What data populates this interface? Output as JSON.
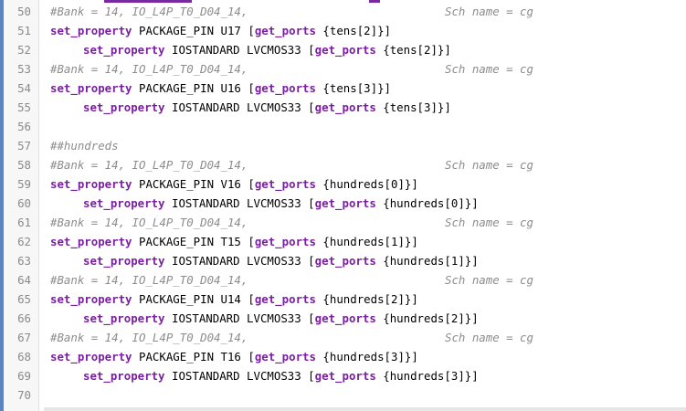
{
  "editor": {
    "lines": [
      {
        "num": "50",
        "kind": "comment",
        "comment": "#Bank = 14, IO_L4P_T0_D04_14,",
        "right": "Sch name = cg"
      },
      {
        "num": "51",
        "kind": "pin",
        "cmd": "set_property",
        "mid": " PACKAGE_PIN U17 [",
        "kw2": "get_ports",
        "tail": " {tens[2]}]"
      },
      {
        "num": "52",
        "kind": "std",
        "cmd": "set_property",
        "mid": " IOSTANDARD LVCMOS33 [",
        "kw2": "get_ports",
        "tail": " {tens[2]}]"
      },
      {
        "num": "53",
        "kind": "comment",
        "comment": "#Bank = 14, IO_L4P_T0_D04_14,",
        "right": "Sch name = cg"
      },
      {
        "num": "54",
        "kind": "pin",
        "cmd": "set_property",
        "mid": " PACKAGE_PIN U16 [",
        "kw2": "get_ports",
        "tail": " {tens[3]}]"
      },
      {
        "num": "55",
        "kind": "std",
        "cmd": "set_property",
        "mid": " IOSTANDARD LVCMOS33 [",
        "kw2": "get_ports",
        "tail": " {tens[3]}]"
      },
      {
        "num": "56",
        "kind": "blank"
      },
      {
        "num": "57",
        "kind": "comment",
        "comment": "##hundreds",
        "right": ""
      },
      {
        "num": "58",
        "kind": "comment",
        "comment": "#Bank = 14, IO_L4P_T0_D04_14,",
        "right": "Sch name = cg"
      },
      {
        "num": "59",
        "kind": "pin",
        "cmd": "set_property",
        "mid": " PACKAGE_PIN V16 [",
        "kw2": "get_ports",
        "tail": " {hundreds[0]}]"
      },
      {
        "num": "60",
        "kind": "std",
        "cmd": "set_property",
        "mid": " IOSTANDARD LVCMOS33 [",
        "kw2": "get_ports",
        "tail": " {hundreds[0]}]"
      },
      {
        "num": "61",
        "kind": "comment",
        "comment": "#Bank = 14, IO_L4P_T0_D04_14,",
        "right": "Sch name = cg"
      },
      {
        "num": "62",
        "kind": "pin",
        "cmd": "set_property",
        "mid": " PACKAGE_PIN T15 [",
        "kw2": "get_ports",
        "tail": " {hundreds[1]}]"
      },
      {
        "num": "63",
        "kind": "std",
        "cmd": "set_property",
        "mid": " IOSTANDARD LVCMOS33 [",
        "kw2": "get_ports",
        "tail": " {hundreds[1]}]"
      },
      {
        "num": "64",
        "kind": "comment",
        "comment": "#Bank = 14, IO_L4P_T0_D04_14,",
        "right": "Sch name = cg"
      },
      {
        "num": "65",
        "kind": "pin",
        "cmd": "set_property",
        "mid": " PACKAGE_PIN U14 [",
        "kw2": "get_ports",
        "tail": " {hundreds[2]}]"
      },
      {
        "num": "66",
        "kind": "std",
        "cmd": "set_property",
        "mid": " IOSTANDARD LVCMOS33 [",
        "kw2": "get_ports",
        "tail": " {hundreds[2]}]"
      },
      {
        "num": "67",
        "kind": "comment",
        "comment": "#Bank = 14, IO_L4P_T0_D04_14,",
        "right": "Sch name = cg"
      },
      {
        "num": "68",
        "kind": "pin",
        "cmd": "set_property",
        "mid": " PACKAGE_PIN T16 [",
        "kw2": "get_ports",
        "tail": " {hundreds[3]}]"
      },
      {
        "num": "69",
        "kind": "std",
        "cmd": "set_property",
        "mid": " IOSTANDARD LVCMOS33 [",
        "kw2": "get_ports",
        "tail": " {hundreds[3]}]"
      },
      {
        "num": "70",
        "kind": "blank"
      }
    ]
  },
  "colors": {
    "keyword": "#7b1fa2",
    "comment": "#8c8c8c",
    "line_number": "#8a8a8a",
    "accent_bar": "#5b86c4"
  }
}
